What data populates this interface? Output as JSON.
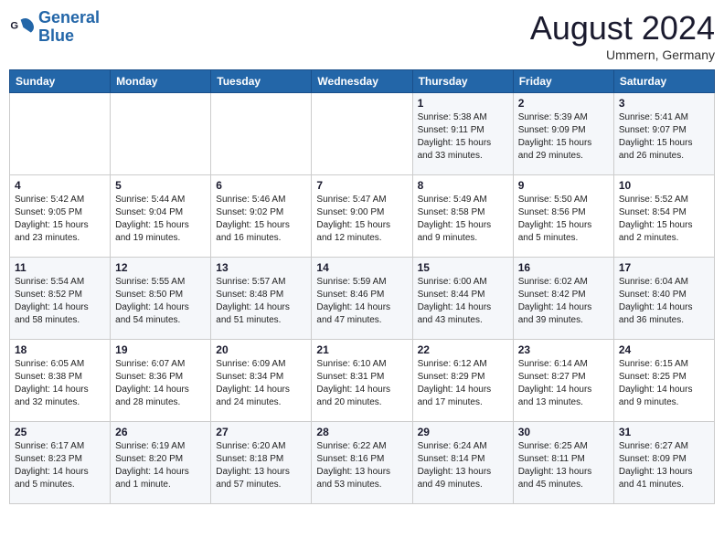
{
  "header": {
    "logo_general": "General",
    "logo_blue": "Blue",
    "month": "August 2024",
    "location": "Ummern, Germany"
  },
  "days_of_week": [
    "Sunday",
    "Monday",
    "Tuesday",
    "Wednesday",
    "Thursday",
    "Friday",
    "Saturday"
  ],
  "weeks": [
    [
      {
        "day": "",
        "info": ""
      },
      {
        "day": "",
        "info": ""
      },
      {
        "day": "",
        "info": ""
      },
      {
        "day": "",
        "info": ""
      },
      {
        "day": "1",
        "info": "Sunrise: 5:38 AM\nSunset: 9:11 PM\nDaylight: 15 hours\nand 33 minutes."
      },
      {
        "day": "2",
        "info": "Sunrise: 5:39 AM\nSunset: 9:09 PM\nDaylight: 15 hours\nand 29 minutes."
      },
      {
        "day": "3",
        "info": "Sunrise: 5:41 AM\nSunset: 9:07 PM\nDaylight: 15 hours\nand 26 minutes."
      }
    ],
    [
      {
        "day": "4",
        "info": "Sunrise: 5:42 AM\nSunset: 9:05 PM\nDaylight: 15 hours\nand 23 minutes."
      },
      {
        "day": "5",
        "info": "Sunrise: 5:44 AM\nSunset: 9:04 PM\nDaylight: 15 hours\nand 19 minutes."
      },
      {
        "day": "6",
        "info": "Sunrise: 5:46 AM\nSunset: 9:02 PM\nDaylight: 15 hours\nand 16 minutes."
      },
      {
        "day": "7",
        "info": "Sunrise: 5:47 AM\nSunset: 9:00 PM\nDaylight: 15 hours\nand 12 minutes."
      },
      {
        "day": "8",
        "info": "Sunrise: 5:49 AM\nSunset: 8:58 PM\nDaylight: 15 hours\nand 9 minutes."
      },
      {
        "day": "9",
        "info": "Sunrise: 5:50 AM\nSunset: 8:56 PM\nDaylight: 15 hours\nand 5 minutes."
      },
      {
        "day": "10",
        "info": "Sunrise: 5:52 AM\nSunset: 8:54 PM\nDaylight: 15 hours\nand 2 minutes."
      }
    ],
    [
      {
        "day": "11",
        "info": "Sunrise: 5:54 AM\nSunset: 8:52 PM\nDaylight: 14 hours\nand 58 minutes."
      },
      {
        "day": "12",
        "info": "Sunrise: 5:55 AM\nSunset: 8:50 PM\nDaylight: 14 hours\nand 54 minutes."
      },
      {
        "day": "13",
        "info": "Sunrise: 5:57 AM\nSunset: 8:48 PM\nDaylight: 14 hours\nand 51 minutes."
      },
      {
        "day": "14",
        "info": "Sunrise: 5:59 AM\nSunset: 8:46 PM\nDaylight: 14 hours\nand 47 minutes."
      },
      {
        "day": "15",
        "info": "Sunrise: 6:00 AM\nSunset: 8:44 PM\nDaylight: 14 hours\nand 43 minutes."
      },
      {
        "day": "16",
        "info": "Sunrise: 6:02 AM\nSunset: 8:42 PM\nDaylight: 14 hours\nand 39 minutes."
      },
      {
        "day": "17",
        "info": "Sunrise: 6:04 AM\nSunset: 8:40 PM\nDaylight: 14 hours\nand 36 minutes."
      }
    ],
    [
      {
        "day": "18",
        "info": "Sunrise: 6:05 AM\nSunset: 8:38 PM\nDaylight: 14 hours\nand 32 minutes."
      },
      {
        "day": "19",
        "info": "Sunrise: 6:07 AM\nSunset: 8:36 PM\nDaylight: 14 hours\nand 28 minutes."
      },
      {
        "day": "20",
        "info": "Sunrise: 6:09 AM\nSunset: 8:34 PM\nDaylight: 14 hours\nand 24 minutes."
      },
      {
        "day": "21",
        "info": "Sunrise: 6:10 AM\nSunset: 8:31 PM\nDaylight: 14 hours\nand 20 minutes."
      },
      {
        "day": "22",
        "info": "Sunrise: 6:12 AM\nSunset: 8:29 PM\nDaylight: 14 hours\nand 17 minutes."
      },
      {
        "day": "23",
        "info": "Sunrise: 6:14 AM\nSunset: 8:27 PM\nDaylight: 14 hours\nand 13 minutes."
      },
      {
        "day": "24",
        "info": "Sunrise: 6:15 AM\nSunset: 8:25 PM\nDaylight: 14 hours\nand 9 minutes."
      }
    ],
    [
      {
        "day": "25",
        "info": "Sunrise: 6:17 AM\nSunset: 8:23 PM\nDaylight: 14 hours\nand 5 minutes."
      },
      {
        "day": "26",
        "info": "Sunrise: 6:19 AM\nSunset: 8:20 PM\nDaylight: 14 hours\nand 1 minute."
      },
      {
        "day": "27",
        "info": "Sunrise: 6:20 AM\nSunset: 8:18 PM\nDaylight: 13 hours\nand 57 minutes."
      },
      {
        "day": "28",
        "info": "Sunrise: 6:22 AM\nSunset: 8:16 PM\nDaylight: 13 hours\nand 53 minutes."
      },
      {
        "day": "29",
        "info": "Sunrise: 6:24 AM\nSunset: 8:14 PM\nDaylight: 13 hours\nand 49 minutes."
      },
      {
        "day": "30",
        "info": "Sunrise: 6:25 AM\nSunset: 8:11 PM\nDaylight: 13 hours\nand 45 minutes."
      },
      {
        "day": "31",
        "info": "Sunrise: 6:27 AM\nSunset: 8:09 PM\nDaylight: 13 hours\nand 41 minutes."
      }
    ]
  ]
}
